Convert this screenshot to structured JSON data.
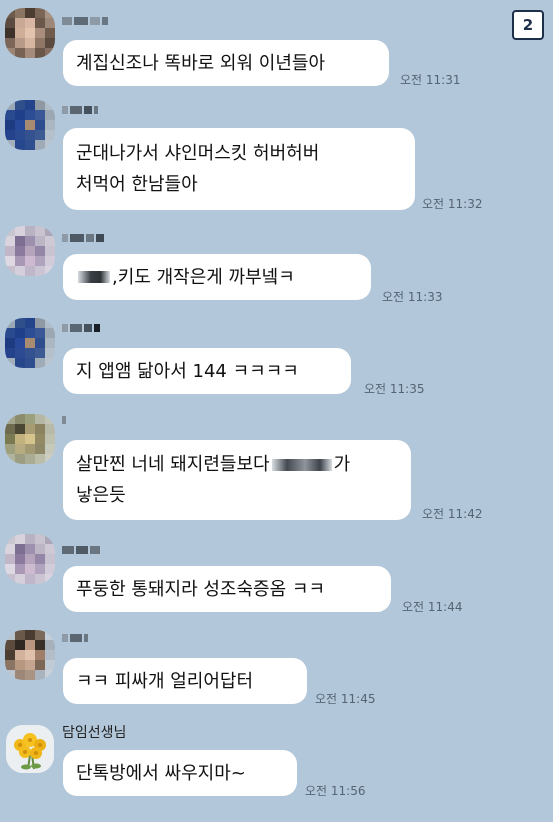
{
  "page_badge": "2",
  "messages": [
    {
      "name": "",
      "lines": [
        "계집신조나 똑바로 외워 이년들아"
      ],
      "time": "오전 11:31"
    },
    {
      "name": "",
      "lines": [
        "군대나가서 샤인머스킷 허버허버",
        "처먹어 한남들아"
      ],
      "time": "오전 11:32"
    },
    {
      "name": "",
      "prefix": ",",
      "lines": [
        " 키도 개작은게 까부넼ㅋ"
      ],
      "time": "오전 11:33"
    },
    {
      "name": "",
      "lines": [
        "지 앱앰 닮아서 144 ㅋㅋㅋㅋ"
      ],
      "time": "오전 11:35"
    },
    {
      "name": "",
      "lines": [
        "살만찐 너네 돼지련들보다",
        "낳은듯"
      ],
      "suffix": "가",
      "time": "오전 11:42"
    },
    {
      "name": "",
      "lines": [
        "푸둥한 통돼지라 성조숙증옴 ㅋㅋ"
      ],
      "time": "오전 11:44"
    },
    {
      "name": "",
      "lines": [
        "ㅋㅋ 피싸개 얼리어답터"
      ],
      "time": "오전 11:45"
    },
    {
      "name": "담임선생님",
      "lines": [
        "단톡방에서 싸우지마~"
      ],
      "time": "오전 11:56"
    }
  ],
  "colors": {
    "background": "#b2c7da",
    "bubble": "#ffffff",
    "badge_border": "#1e2f4a"
  }
}
